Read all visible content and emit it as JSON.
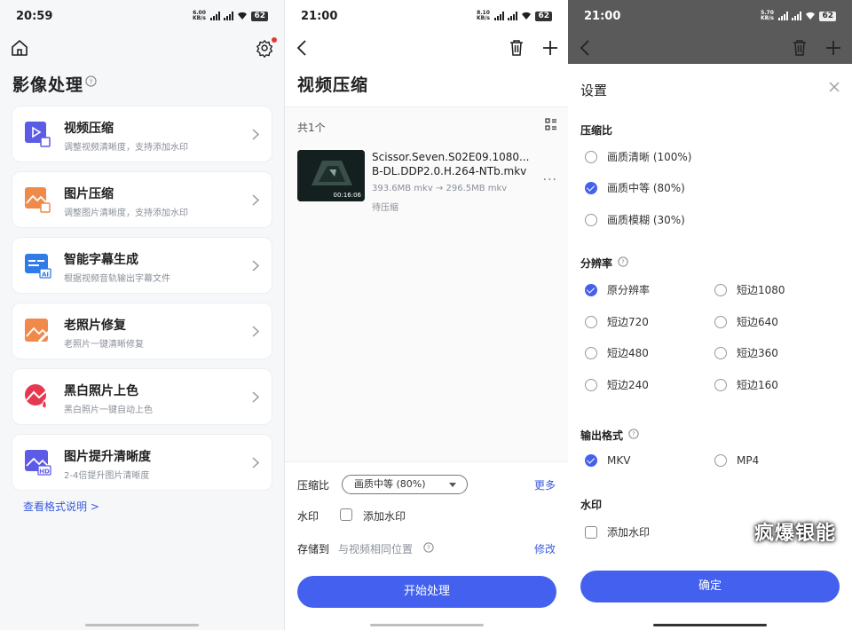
{
  "panel1": {
    "time": "20:59",
    "net_speed": "6.00 KB/s",
    "battery": "62",
    "title": "影像处理",
    "items": [
      {
        "title": "视频压缩",
        "subtitle": "调整视频清晰度，支持添加水印",
        "icon": "video-compress-icon"
      },
      {
        "title": "图片压缩",
        "subtitle": "调整图片清晰度，支持添加水印",
        "icon": "image-compress-icon"
      },
      {
        "title": "智能字幕生成",
        "subtitle": "根据视频音轨输出字幕文件",
        "icon": "subtitle-ai-icon"
      },
      {
        "title": "老照片修复",
        "subtitle": "老照片一键清晰修复",
        "icon": "photo-restore-icon"
      },
      {
        "title": "黑白照片上色",
        "subtitle": "黑白照片一键自动上色",
        "icon": "colorize-icon"
      },
      {
        "title": "图片提升清晰度",
        "subtitle": "2-4倍提升图片清晰度",
        "icon": "hd-enhance-icon"
      }
    ],
    "format_link": "查看格式说明 >"
  },
  "panel2": {
    "time": "21:00",
    "net_speed": "8.10 KB/s",
    "battery": "62",
    "title": "视频压缩",
    "count": "共1个",
    "file": {
      "name": "Scissor.Seven.S02E09.1080... B-DL.DDP2.0.H.264-NTb.mkv",
      "size": "393.6MB mkv → 296.5MB mkv",
      "status": "待压缩",
      "duration": "00:16:06"
    },
    "ratio_label": "压缩比",
    "ratio_value": "画质中等 (80%)",
    "more": "更多",
    "watermark_label": "水印",
    "watermark_option": "添加水印",
    "store_label": "存储到",
    "store_value": "与视频相同位置",
    "modify": "修改",
    "start": "开始处理"
  },
  "panel3": {
    "time": "21:00",
    "net_speed": "5.70 KB/s",
    "battery": "62",
    "sheet_title": "设置",
    "ratio_section": "压缩比",
    "ratio_options": [
      {
        "label": "画质清晰 (100%)",
        "selected": false
      },
      {
        "label": "画质中等 (80%)",
        "selected": true
      },
      {
        "label": "画质模糊 (30%)",
        "selected": false
      }
    ],
    "resolution_section": "分辨率",
    "resolution_options": [
      {
        "label": "原分辨率",
        "selected": true
      },
      {
        "label": "短边1080",
        "selected": false
      },
      {
        "label": "短边720",
        "selected": false
      },
      {
        "label": "短边640",
        "selected": false
      },
      {
        "label": "短边480",
        "selected": false
      },
      {
        "label": "短边360",
        "selected": false
      },
      {
        "label": "短边240",
        "selected": false
      },
      {
        "label": "短边160",
        "selected": false
      }
    ],
    "format_section": "输出格式",
    "format_options": [
      {
        "label": "MKV",
        "selected": true
      },
      {
        "label": "MP4",
        "selected": false
      }
    ],
    "watermark_section": "水印",
    "watermark_option": "添加水印",
    "confirm": "确定"
  },
  "watermark": "疯爆银能",
  "colors": {
    "accent": "#4361ee",
    "link": "#3b5bdb"
  }
}
